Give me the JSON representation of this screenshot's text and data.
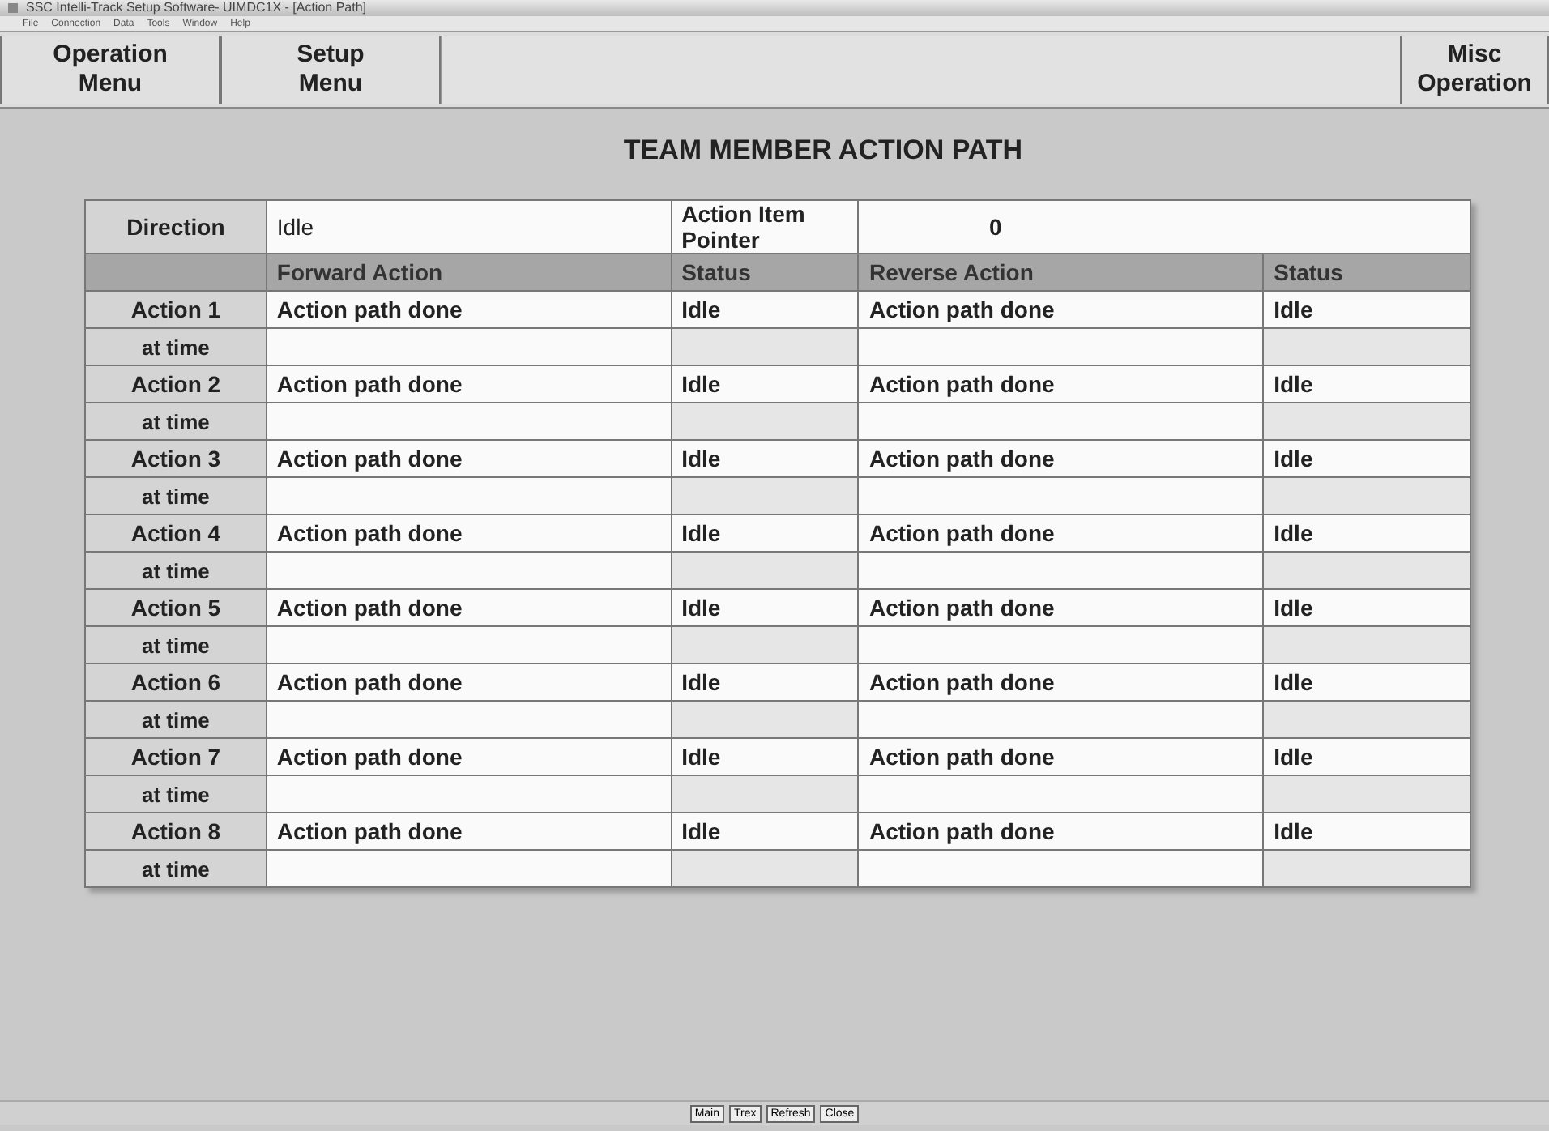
{
  "window": {
    "title": "SSC Intelli-Track Setup Software- UIMDC1X - [Action Path]"
  },
  "menu": [
    "File",
    "Connection",
    "Data",
    "Tools",
    "Window",
    "Help"
  ],
  "toolbar": {
    "left": [
      {
        "line1": "Operation",
        "line2": "Menu"
      },
      {
        "line1": "Setup",
        "line2": "Menu"
      }
    ],
    "right": {
      "line1": "Misc",
      "line2": "Operation"
    }
  },
  "heading": "TEAM MEMBER ACTION PATH",
  "direction": {
    "label": "Direction",
    "value": "Idle",
    "pointer_label": "Action Item Pointer",
    "pointer_value": "0"
  },
  "columns": [
    "Forward Action",
    "Status",
    "Reverse Action",
    "Status"
  ],
  "actions": [
    {
      "label": "Action 1",
      "forward": "Action path done",
      "status": "Idle",
      "reverse": "Action path done",
      "reverse_status": "Idle",
      "time_label": "at time"
    },
    {
      "label": "Action 2",
      "forward": "Action path done",
      "status": "Idle",
      "reverse": "Action path done",
      "reverse_status": "Idle",
      "time_label": "at time"
    },
    {
      "label": "Action 3",
      "forward": "Action path done",
      "status": "Idle",
      "reverse": "Action path done",
      "reverse_status": "Idle",
      "time_label": "at time"
    },
    {
      "label": "Action 4",
      "forward": "Action path done",
      "status": "Idle",
      "reverse": "Action path done",
      "reverse_status": "Idle",
      "time_label": "at time"
    },
    {
      "label": "Action 5",
      "forward": "Action path done",
      "status": "Idle",
      "reverse": "Action path done",
      "reverse_status": "Idle",
      "time_label": "at time"
    },
    {
      "label": "Action 6",
      "forward": "Action path done",
      "status": "Idle",
      "reverse": "Action path done",
      "reverse_status": "Idle",
      "time_label": "at time"
    },
    {
      "label": "Action 7",
      "forward": "Action path done",
      "status": "Idle",
      "reverse": "Action path done",
      "reverse_status": "Idle",
      "time_label": "at time"
    },
    {
      "label": "Action 8",
      "forward": "Action path done",
      "status": "Idle",
      "reverse": "Action path done",
      "reverse_status": "Idle",
      "time_label": "at time"
    }
  ],
  "status_bar": {
    "buttons": [
      "Main",
      "Trex",
      "Refresh",
      "Close"
    ]
  }
}
